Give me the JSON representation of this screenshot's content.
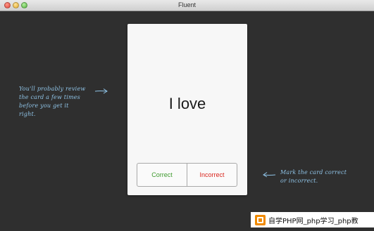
{
  "window": {
    "title": "Fluent"
  },
  "card": {
    "word": "I love",
    "buttons": {
      "correct": "Correct",
      "incorrect": "Incorrect"
    }
  },
  "annotations": {
    "left": [
      "You'll probably review",
      "the card a few times",
      "before you get it",
      "right."
    ],
    "right": [
      "Mark the card correct",
      "or incorrect."
    ]
  },
  "watermark": {
    "text": "自学PHP网_php学习_php教"
  },
  "colors": {
    "background": "#2f2f2f",
    "card": "#f7f7f7",
    "correct": "#3e9a2e",
    "incorrect": "#d9241c",
    "annotation": "#8fc3e6"
  }
}
